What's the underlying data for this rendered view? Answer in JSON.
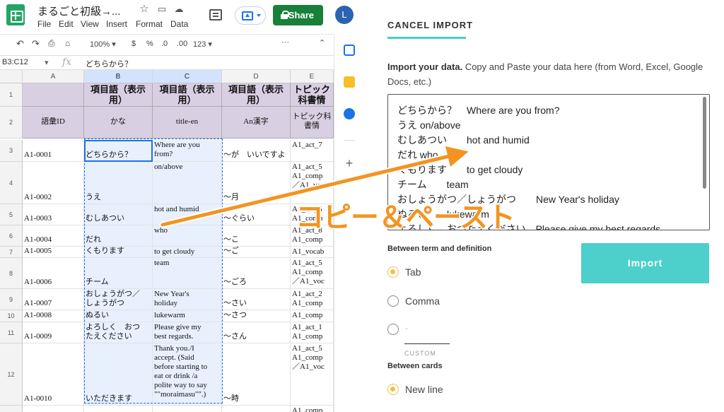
{
  "sheets": {
    "doc_title": "まるごと初級→...",
    "menu": [
      "File",
      "Edit",
      "View",
      "Insert",
      "Format",
      "Data"
    ],
    "share_label": "Share",
    "avatar_letter": "L",
    "toolbar": {
      "zoom": "100%",
      "currency": "$",
      "percent": "%",
      "dec_down": ".0",
      "dec_up": ".00",
      "format_more": "123",
      "more": "···"
    },
    "formula_bar": {
      "name_box": "B3:C12",
      "fx": "fx",
      "value": "どちらから？"
    },
    "columns": [
      "A",
      "B",
      "C",
      "D",
      "E"
    ],
    "header_rows": [
      {
        "num": "1",
        "cells": [
          "",
          "項目語（表示用）",
          "項目語（表示用）",
          "項目語（表示用）",
          "トピック科書情"
        ]
      },
      {
        "num": "2",
        "cells": [
          "語彙ID",
          "かな",
          "title-en",
          "An漢字",
          "トピック科書情"
        ]
      }
    ],
    "rows": [
      {
        "num": "3",
        "a": "A1-0001",
        "b": "どちらから？",
        "c": "Where are you\nfrom?",
        "d": "〜が　いいですよ",
        "e": "A1_act_7"
      },
      {
        "num": "4",
        "a": "A1-0002",
        "b": "うえ",
        "c": "on/above",
        "d": "〜月",
        "e": "A1_act_5\nA1_comp\n／A1_vo"
      },
      {
        "num": "5",
        "a": "A1-0003",
        "b": "むしあつい",
        "c": "hot and humid",
        "d": "〜ぐらい",
        "e": "A1_act_5\nA1_comp"
      },
      {
        "num": "6",
        "a": "A1-0004",
        "b": "だれ",
        "c": "who",
        "d": "〜こ",
        "e": "A1_act_8\nA1_comp"
      },
      {
        "num": "7",
        "a": "A1-0005",
        "b": "くもります",
        "c": "to get cloudy",
        "d": "〜ご",
        "e": "A1_vocab"
      },
      {
        "num": "8",
        "a": "A1-0006",
        "b": "チーム",
        "c": "team",
        "d": "〜ごろ",
        "e": "A1_act_5\nA1_comp\n／A1_voc"
      },
      {
        "num": "9",
        "a": "A1-0007",
        "b": "おしょうがつ／\nしょうがつ",
        "c": "New Year's\nholiday",
        "d": "〜さい",
        "e": "A1_act_2\nA1_comp"
      },
      {
        "num": "10",
        "a": "A1-0008",
        "b": "ぬるい",
        "c": "lukewarm",
        "d": "〜さつ",
        "e": "A1_comp"
      },
      {
        "num": "11",
        "a": "A1-0009",
        "b": "よろしく　おつ\nたえください",
        "c": "Please give my\nbest regards.",
        "d": "〜さん",
        "e": "A1_act_1\nA1_comp"
      },
      {
        "num": "12",
        "a": "A1-0010",
        "b": "いただきます",
        "c": "Thank you./I\naccept. (Said\nbefore starting to\neat or drink /a\npolite way to say\n\"\"moraimasu\"\".)",
        "d": "〜時",
        "e": "A1_act_5\nA1_comp\n／A1_voc"
      },
      {
        "num": "13",
        "a": "",
        "b": "",
        "c": "",
        "d": "",
        "e": "A1_comp"
      }
    ]
  },
  "import_panel": {
    "cancel_label": "CANCEL IMPORT",
    "instructions_bold": "Import your data.",
    "instructions": " Copy and Paste your data here (from Word, Excel, Google Docs, etc.)",
    "textarea_value": "どちらから？　Where are you from?\nうえ on/above\nむしあつい　　hot and humid\nだれ who\nくもります　　to get cloudy\nチーム　　team\nおしょうがつ／しょうがつ　　New Year's holiday\nぬるい　　lukewarm\nよろしく　おつたえください　Please give my best regards",
    "between_term_label": "Between term and definition",
    "term_options": [
      "Tab",
      "Comma",
      "-"
    ],
    "term_selected": "Tab",
    "custom_label": "CUSTOM",
    "between_cards_label": "Between cards",
    "card_options": [
      "New line"
    ],
    "card_selected": "New line",
    "import_button": "Import"
  },
  "overlay": {
    "annotation": "コピー＆ペースト",
    "arrow_color": "#f39422"
  }
}
